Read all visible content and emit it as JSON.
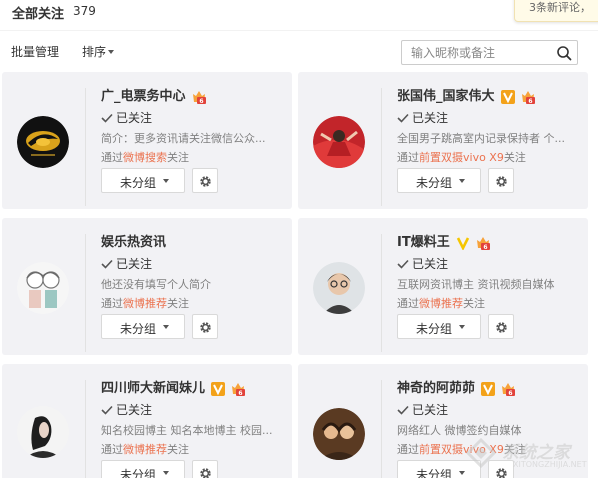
{
  "header": {
    "title": "全部关注",
    "count": "379"
  },
  "notification": {
    "text": "3条新评论，"
  },
  "toolbar": {
    "batch_label": "批量管理",
    "sort_label": "排序"
  },
  "search": {
    "placeholder": "输入昵称或备注",
    "value": ""
  },
  "cards": [
    {
      "name": "广_电票务中心",
      "followed": "已关注",
      "desc": "简介：更多资讯请关注微信公众...",
      "via_prefix": "通过",
      "via_link": "微博搜索",
      "via_suffix": "关注",
      "group": "未分组",
      "badge": "none"
    },
    {
      "name": "张国伟_国家伟大",
      "followed": "已关注",
      "desc": "全国男子跳高室内记录保持者 个...",
      "via_prefix": "通过",
      "via_link": "前置双摄vivo X9",
      "via_suffix": "关注",
      "group": "未分组",
      "badge": "orange"
    },
    {
      "name": "娱乐热资讯",
      "followed": "已关注",
      "desc": "他还没有填写个人简介",
      "via_prefix": "通过",
      "via_link": "微博推荐",
      "via_suffix": "关注",
      "group": "未分组",
      "badge": "none"
    },
    {
      "name": "IT爆料王",
      "followed": "已关注",
      "desc": "互联网资讯博主 资讯视频自媒体",
      "via_prefix": "通过",
      "via_link": "微博推荐",
      "via_suffix": "关注",
      "group": "未分组",
      "badge": "yellow"
    },
    {
      "name": "四川师大新闻妹儿",
      "followed": "已关注",
      "desc": "知名校园博主 知名本地博主 校园...",
      "via_prefix": "通过",
      "via_link": "微博推荐",
      "via_suffix": "关注",
      "group": "未分组",
      "badge": "orange"
    },
    {
      "name": "神奇的阿茆茆",
      "followed": "已关注",
      "desc": "网络红人 微博签约自媒体",
      "via_prefix": "通过",
      "via_link": "前置双摄vivo X9",
      "via_suffix": "关注",
      "group": "未分组",
      "badge": "orange"
    }
  ],
  "watermark": {
    "text": "系统之家",
    "sub": "XITONGZHIJIA.NET"
  },
  "colors": {
    "accent": "#eb7350",
    "card_bg": "#f2f2f5",
    "verified_orange": "#f3a21a",
    "verified_yellow": "#f5c600"
  }
}
